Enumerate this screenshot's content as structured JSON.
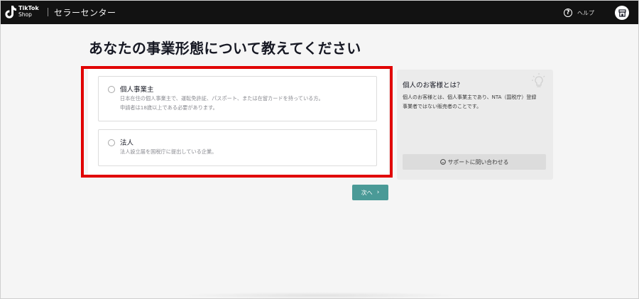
{
  "header": {
    "logo_line1": "TikTok",
    "logo_line2": "Shop",
    "app_title": "セラーセンター",
    "help_label": "ヘルプ",
    "help_icon": "question-circle-icon",
    "shop_icon": "shop-icon"
  },
  "page": {
    "title": "あなたの事業形態について教えてください"
  },
  "options": [
    {
      "title": "個人事業主",
      "desc_line1": "日本在住の個人事業主で、運転免許証、パスポート、または在留カードを持っている方。",
      "desc_line2": "申請者は18歳以上である必要があります。",
      "selected": false
    },
    {
      "title": "法人",
      "desc_line1": "法人設立届を国税庁に提出している企業。",
      "selected": false
    }
  ],
  "info_card": {
    "title": "個人のお客様とは？",
    "body_line1": "個人のお客様とは、個人事業主であり、NTA（国税庁）登録",
    "body_line2": "事業者ではない販売者のことです。",
    "support_label": "サポートに問い合わせる",
    "icon": "lightbulb-icon"
  },
  "actions": {
    "next_label": "次へ",
    "next_color": "#4a9a97"
  },
  "colors": {
    "header_bg": "#121212",
    "highlight": "#e10000",
    "accent": "#4a9a97"
  }
}
